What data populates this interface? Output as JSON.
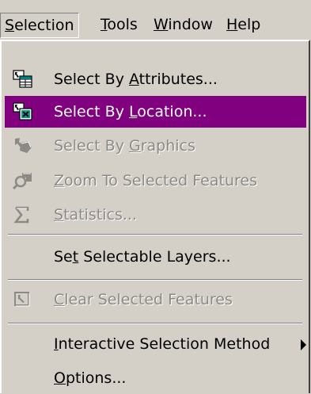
{
  "menubar": {
    "items": [
      {
        "label": "Selection",
        "accel": "S",
        "pressed": true
      },
      {
        "label": "Tools",
        "accel": "T"
      },
      {
        "label": "Window",
        "accel": "W"
      },
      {
        "label": "Help",
        "accel": "H"
      }
    ]
  },
  "menu": {
    "items": [
      {
        "pre": "Select By ",
        "accel": "A",
        "post": "ttributes...",
        "icon": "select-by-attributes-icon",
        "enabled": true
      },
      {
        "pre": "Select By ",
        "accel": "L",
        "post": "ocation...",
        "icon": "select-by-location-icon",
        "enabled": true,
        "highlighted": true
      },
      {
        "pre": "Select By ",
        "accel": "G",
        "post": "raphics",
        "icon": "select-by-graphics-icon",
        "enabled": false
      },
      {
        "pre": "",
        "accel": "Z",
        "post": "oom To Selected Features",
        "icon": "zoom-to-selected-icon",
        "enabled": false
      },
      {
        "pre": "",
        "accel": "S",
        "post": "tatistics...",
        "icon": "statistics-sigma-icon",
        "enabled": false
      },
      {
        "pre": "Se",
        "accel": "t",
        "post": " Selectable Layers...",
        "enabled": true
      },
      {
        "pre": "",
        "accel": "C",
        "post": "lear Selected Features",
        "icon": "clear-selection-icon",
        "enabled": false
      },
      {
        "pre": "",
        "accel": "I",
        "post": "nteractive Selection Method",
        "enabled": true,
        "submenu": true
      },
      {
        "pre": "",
        "accel": "O",
        "post": "ptions...",
        "enabled": true
      }
    ]
  },
  "colors": {
    "highlight": "#800080",
    "menu_bg": "#d4d0c8",
    "disabled_text": "#8c8a84"
  }
}
